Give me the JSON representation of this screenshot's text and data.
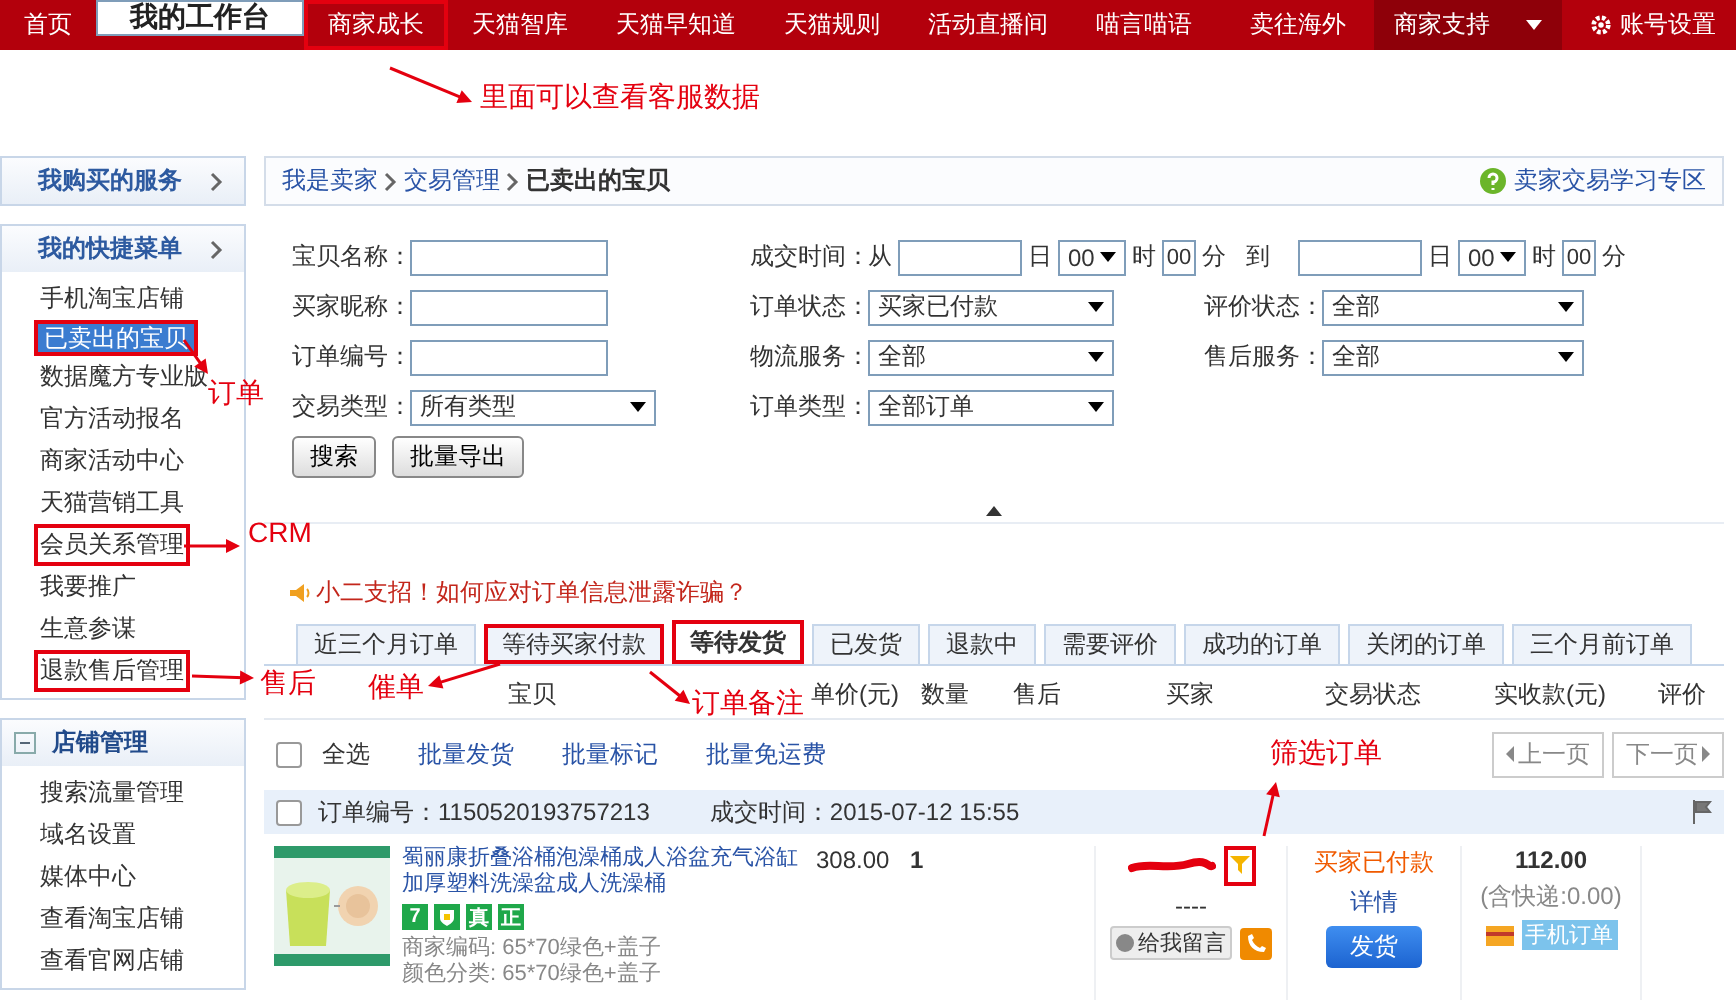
{
  "top_nav": {
    "items": [
      {
        "label": "首页",
        "selected": false,
        "highlighted": false
      },
      {
        "label": "我的工作台",
        "selected": true,
        "highlighted": false
      },
      {
        "label": "商家成长",
        "selected": false,
        "highlighted": true
      },
      {
        "label": "天猫智库",
        "selected": false,
        "highlighted": false
      },
      {
        "label": "天猫早知道",
        "selected": false,
        "highlighted": false
      },
      {
        "label": "天猫规则",
        "selected": false,
        "highlighted": false
      },
      {
        "label": "活动直播间",
        "selected": false,
        "highlighted": false
      },
      {
        "label": "喵言喵语",
        "selected": false,
        "highlighted": false
      }
    ],
    "right_items": [
      {
        "kind": "link",
        "label": "卖往海外"
      },
      {
        "kind": "menu",
        "label": "商家支持"
      },
      {
        "kind": "settings",
        "label": "账号设置"
      }
    ]
  },
  "sidebar": {
    "sections": [
      {
        "kind": "link",
        "title": "我购买的服务"
      },
      {
        "kind": "menu",
        "title": "我的快捷菜单",
        "items": [
          {
            "label": "手机淘宝店铺",
            "selected": false,
            "highlighted": false
          },
          {
            "label": "已卖出的宝贝",
            "selected": true,
            "highlighted": true
          },
          {
            "label": "数据魔方专业版",
            "selected": false,
            "highlighted": false
          },
          {
            "label": "官方活动报名",
            "selected": false,
            "highlighted": false
          },
          {
            "label": "商家活动中心",
            "selected": false,
            "highlighted": false
          },
          {
            "label": "天猫营销工具",
            "selected": false,
            "highlighted": false
          },
          {
            "label": "会员关系管理",
            "selected": false,
            "highlighted": true
          },
          {
            "label": "我要推广",
            "selected": false,
            "highlighted": false
          },
          {
            "label": "生意参谋",
            "selected": false,
            "highlighted": false
          },
          {
            "label": "退款售后管理",
            "selected": false,
            "highlighted": true
          }
        ]
      },
      {
        "kind": "group",
        "title": "店铺管理",
        "expanded": true,
        "items": [
          {
            "label": "搜索流量管理",
            "selected": false,
            "highlighted": false
          },
          {
            "label": "域名设置",
            "selected": false,
            "highlighted": false
          },
          {
            "label": "媒体中心",
            "selected": false,
            "highlighted": false
          },
          {
            "label": "查看淘宝店铺",
            "selected": false,
            "highlighted": false
          },
          {
            "label": "查看官网店铺",
            "selected": false,
            "highlighted": false
          }
        ]
      }
    ]
  },
  "breadcrumb": {
    "items": [
      "我是卖家",
      "交易管理",
      "已卖出的宝贝"
    ],
    "help_link": "卖家交易学习专区"
  },
  "search_form": {
    "rows": [
      [
        {
          "kind": "input",
          "label": "宝贝名称："
        },
        {
          "kind": "date_range",
          "label": "成交时间：",
          "from_word": "从",
          "to_word": "到",
          "start": {
            "day_unit": "日",
            "hour": "00",
            "hour_unit": "时",
            "minute": "00",
            "minute_unit": "分"
          },
          "end": {
            "day_unit": "日",
            "hour": "00",
            "hour_unit": "时",
            "minute": "00",
            "minute_unit": "分"
          }
        }
      ],
      [
        {
          "kind": "input",
          "label": "买家昵称："
        },
        {
          "kind": "select",
          "label": "订单状态：",
          "value": "买家已付款"
        },
        {
          "kind": "select",
          "label": "评价状态：",
          "value": "全部"
        }
      ],
      [
        {
          "kind": "input",
          "label": "订单编号："
        },
        {
          "kind": "select",
          "label": "物流服务：",
          "value": "全部"
        },
        {
          "kind": "select",
          "label": "售后服务：",
          "value": "全部"
        }
      ],
      [
        {
          "kind": "select",
          "label": "交易类型：",
          "value": "所有类型"
        },
        {
          "kind": "select",
          "label": "订单类型：",
          "value": "全部订单"
        }
      ]
    ],
    "buttons": [
      "搜索",
      "批量导出"
    ]
  },
  "tip": "小二支招！如何应对订单信息泄露诈骗？",
  "order_tabs": [
    {
      "label": "近三个月订单",
      "selected": false,
      "highlighted": false
    },
    {
      "label": "等待买家付款",
      "selected": false,
      "highlighted": true
    },
    {
      "label": "等待发货",
      "selected": true,
      "highlighted": true
    },
    {
      "label": "已发货",
      "selected": false,
      "highlighted": false
    },
    {
      "label": "退款中",
      "selected": false,
      "highlighted": false
    },
    {
      "label": "需要评价",
      "selected": false,
      "highlighted": false
    },
    {
      "label": "成功的订单",
      "selected": false,
      "highlighted": false
    },
    {
      "label": "关闭的订单",
      "selected": false,
      "highlighted": false
    },
    {
      "label": "三个月前订单",
      "selected": false,
      "highlighted": false
    }
  ],
  "columns": [
    "宝贝",
    "单价(元)",
    "数量",
    "售后",
    "买家",
    "交易状态",
    "实收款(元)",
    "评价"
  ],
  "toolbar": {
    "select_all": {
      "label": "全选",
      "checked": false
    },
    "actions": [
      "批量发货",
      "批量标记",
      "批量免运费"
    ],
    "pager": {
      "prev": "上一页",
      "next": "下一页"
    }
  },
  "orders": [
    {
      "checked": false,
      "number": "订单编号：1150520193757213",
      "time": "成交时间：2015-07-12 15:55",
      "product": {
        "kind": "picture",
        "title": "蜀丽康折叠浴桶泡澡桶成人浴盆充气浴缸加厚塑料洗澡盆成人洗澡桶",
        "badges": [
          {
            "kind": "text",
            "label": "7"
          },
          {
            "kind": "icon"
          },
          {
            "kind": "text",
            "label": "真"
          },
          {
            "kind": "text",
            "label": "正"
          }
        ],
        "props": [
          "商家编码: 65*70绿色+盖子",
          "颜色分类: 65*70绿色+盖子"
        ]
      },
      "price": "308.00",
      "quantity": "1",
      "buyer": {
        "line": "----",
        "message_button": "给我留言",
        "filter_highlighted": true
      },
      "status": {
        "text": "买家已付款",
        "detail_link": "详情",
        "ship_button": "发货"
      },
      "amount": {
        "total": "112.00",
        "shipping": "(含快递:0.00)",
        "mobile_tag": "手机订单"
      }
    }
  ],
  "annotations": [
    {
      "text": "里面可以查看客服数据"
    },
    {
      "text": "订单"
    },
    {
      "text": "CRM"
    },
    {
      "text": "售后"
    },
    {
      "text": "催单"
    },
    {
      "text": "订单备注"
    },
    {
      "text": "筛选订单"
    }
  ]
}
